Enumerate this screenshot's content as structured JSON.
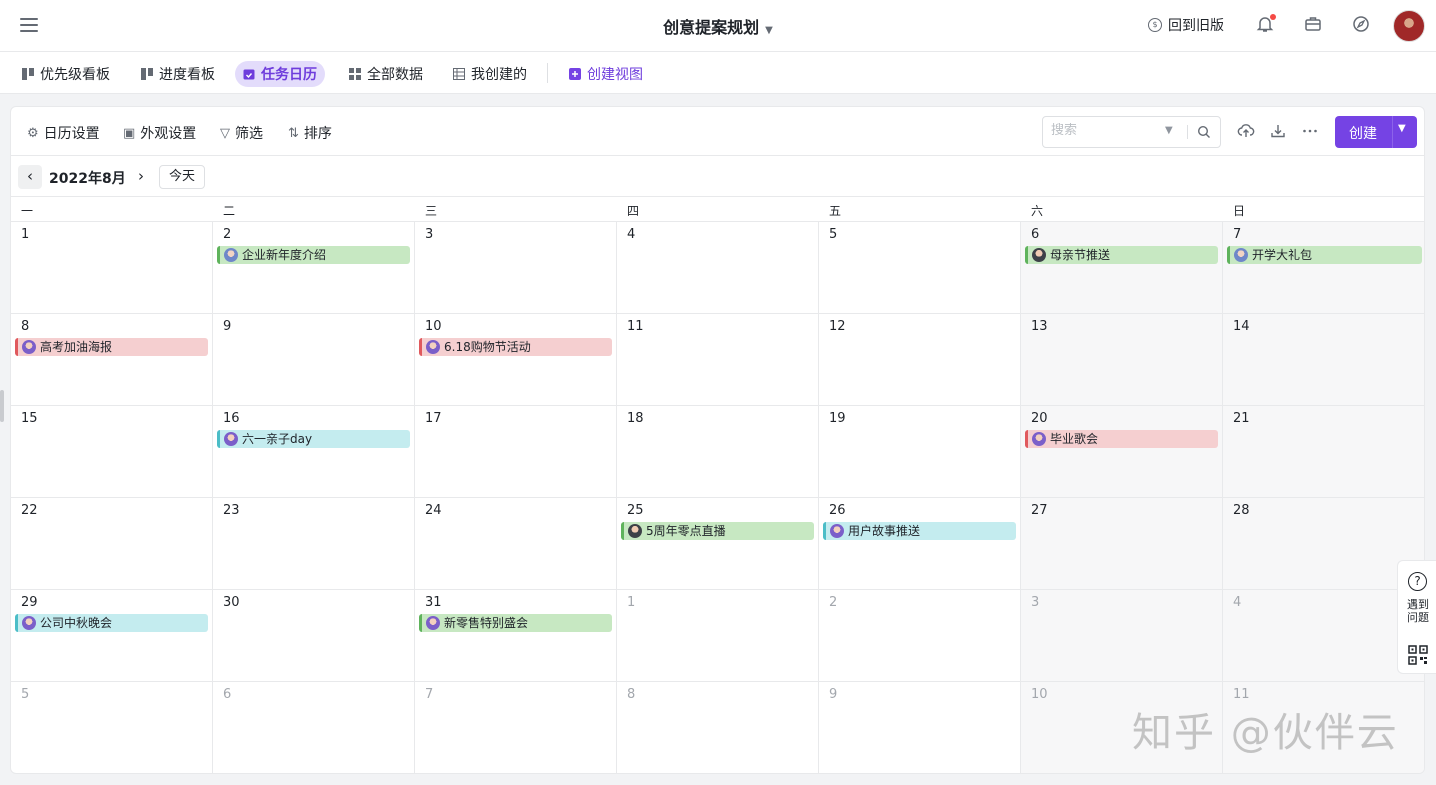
{
  "header": {
    "title": "创意提案规划",
    "old_version": "回到旧版"
  },
  "view_tabs": [
    {
      "label": "优先级看板",
      "active": false
    },
    {
      "label": "进度看板",
      "active": false
    },
    {
      "label": "任务日历",
      "active": true
    },
    {
      "label": "全部数据",
      "active": false
    },
    {
      "label": "我创建的",
      "active": false
    }
  ],
  "create_view": "创建视图",
  "toolbar": {
    "calendar_settings": "日历设置",
    "appearance_settings": "外观设置",
    "filter": "筛选",
    "sort": "排序",
    "search_placeholder": "搜索",
    "create": "创建"
  },
  "calendar": {
    "month_label": "2022年8月",
    "today": "今天",
    "weekdays": [
      "一",
      "二",
      "三",
      "四",
      "五",
      "六",
      "日"
    ],
    "weeks": [
      [
        {
          "day": "1",
          "other": false
        },
        {
          "day": "2",
          "other": false,
          "event": {
            "title": "企业新年度介绍",
            "color": "green",
            "avatar": "av1"
          }
        },
        {
          "day": "3",
          "other": false
        },
        {
          "day": "4",
          "other": false
        },
        {
          "day": "5",
          "other": false
        },
        {
          "day": "6",
          "other": false,
          "event": {
            "title": "母亲节推送",
            "color": "green",
            "avatar": "av2"
          }
        },
        {
          "day": "7",
          "other": false,
          "event": {
            "title": "开学大礼包",
            "color": "green",
            "avatar": "av1"
          }
        }
      ],
      [
        {
          "day": "8",
          "other": false,
          "event": {
            "title": "高考加油海报",
            "color": "red",
            "avatar": "av3"
          }
        },
        {
          "day": "9",
          "other": false
        },
        {
          "day": "10",
          "other": false,
          "event": {
            "title": "6.18购物节活动",
            "color": "red",
            "avatar": "av3"
          }
        },
        {
          "day": "11",
          "other": false
        },
        {
          "day": "12",
          "other": false
        },
        {
          "day": "13",
          "other": false
        },
        {
          "day": "14",
          "other": false
        }
      ],
      [
        {
          "day": "15",
          "other": false
        },
        {
          "day": "16",
          "other": false,
          "event": {
            "title": "六一亲子day",
            "color": "cyan",
            "avatar": "av3"
          }
        },
        {
          "day": "17",
          "other": false
        },
        {
          "day": "18",
          "other": false
        },
        {
          "day": "19",
          "other": false
        },
        {
          "day": "20",
          "other": false,
          "event": {
            "title": "毕业歌会",
            "color": "red",
            "avatar": "av3"
          }
        },
        {
          "day": "21",
          "other": false
        }
      ],
      [
        {
          "day": "22",
          "other": false
        },
        {
          "day": "23",
          "other": false
        },
        {
          "day": "24",
          "other": false
        },
        {
          "day": "25",
          "other": false,
          "event": {
            "title": "5周年零点直播",
            "color": "green",
            "avatar": "av2"
          }
        },
        {
          "day": "26",
          "other": false,
          "event": {
            "title": "用户故事推送",
            "color": "cyan",
            "avatar": "av3"
          }
        },
        {
          "day": "27",
          "other": false
        },
        {
          "day": "28",
          "other": false
        }
      ],
      [
        {
          "day": "29",
          "other": false,
          "event": {
            "title": "公司中秋晚会",
            "color": "cyan",
            "avatar": "av3"
          }
        },
        {
          "day": "30",
          "other": false
        },
        {
          "day": "31",
          "other": false,
          "event": {
            "title": "新零售特别盛会",
            "color": "green",
            "avatar": "av3"
          }
        },
        {
          "day": "1",
          "other": true
        },
        {
          "day": "2",
          "other": true
        },
        {
          "day": "3",
          "other": true
        },
        {
          "day": "4",
          "other": true
        }
      ],
      [
        {
          "day": "5",
          "other": true
        },
        {
          "day": "6",
          "other": true
        },
        {
          "day": "7",
          "other": true
        },
        {
          "day": "8",
          "other": true
        },
        {
          "day": "9",
          "other": true
        },
        {
          "day": "10",
          "other": true
        },
        {
          "day": "11",
          "other": true
        }
      ]
    ]
  },
  "help": {
    "label": "遇到问题"
  },
  "watermark": "知乎 @伙伴云",
  "colors": {
    "accent": "#7543e4",
    "event_green": "#c7e8c2",
    "event_red": "#f5cfd0",
    "event_cyan": "#c4ecef"
  }
}
